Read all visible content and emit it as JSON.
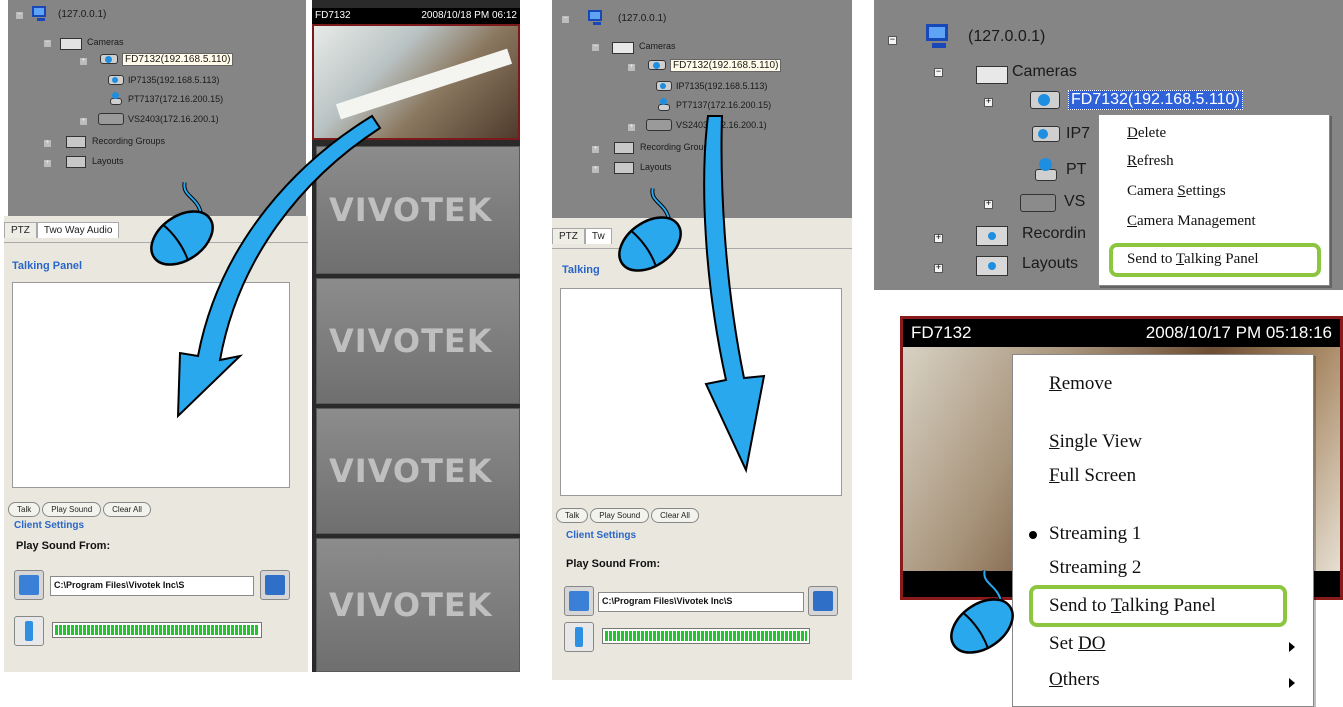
{
  "tree": {
    "root": "(127.0.0.1)",
    "cameras": "Cameras",
    "items": [
      "FD7132(192.168.5.110)",
      "IP7135(192.168.5.113)",
      "PT7137(172.16.200.15)",
      "VS2403(172.16.200.1)"
    ],
    "recording_groups": "Recording Groups",
    "layouts": "Layouts"
  },
  "tree_crop": {
    "root": "(127.0.0.1)",
    "cameras": "Cameras",
    "selected": "FD7132(192.168.5.110)",
    "ip_partial": "IP7",
    "pt_partial": "PT",
    "vs_partial": "VS",
    "recording_partial": "Recordin",
    "layouts": "Layouts"
  },
  "tabs": {
    "ptz": "PTZ",
    "two_way": "Two Way Audio",
    "two_way_partial": "Tw"
  },
  "talking_panel": {
    "title": "Talking Panel",
    "title_partial": "Talking",
    "buttons": [
      "Talk",
      "Play Sound",
      "Clear All"
    ],
    "client_settings": "Client Settings",
    "play_sound_from": "Play Sound From:",
    "path": "C:\\Program Files\\Vivotek Inc\\S"
  },
  "video": {
    "camera": "FD7132",
    "datetime_partial": "2008/10/18 PM 06:12",
    "camera2": "FD7132",
    "datetime2": "2008/10/17 PM 05:18:16",
    "logo": "VIVOTEK"
  },
  "tree_menu": {
    "items": [
      {
        "pre": "",
        "acc": "D",
        "post": "elete"
      },
      {
        "pre": "",
        "acc": "R",
        "post": "efresh"
      },
      {
        "pre": "Camera ",
        "acc": "S",
        "post": "ettings"
      },
      {
        "pre": "",
        "acc": "C",
        "post": "amera Management"
      },
      {
        "pre": "Send to ",
        "acc": "T",
        "post": "alking Panel"
      }
    ]
  },
  "video_menu": {
    "remove": {
      "acc": "R",
      "post": "emove"
    },
    "single_view": {
      "acc": "S",
      "post": "ingle View"
    },
    "full_screen": {
      "acc": "F",
      "post": "ull Screen"
    },
    "streaming1": "Streaming 1",
    "streaming2": "Streaming 2",
    "send": {
      "pre": "Send to ",
      "acc": "T",
      "post": "alking Panel"
    },
    "set_do": {
      "pre": "Set ",
      "acc": "DO",
      "post": ""
    },
    "others": {
      "pre": "",
      "acc": "O",
      "post": "thers"
    }
  },
  "colors": {
    "tree_bg": "#858585",
    "highlight_green": "#8cc63f",
    "arrow_blue": "#29a8ee",
    "selection_blue": "#2f62d8",
    "title_blue": "#2a66c8"
  },
  "icons": [
    "monitor-icon",
    "folder-icon",
    "camera-icon",
    "mouse-icon",
    "arrow-icon",
    "speaker-icon",
    "microphone-icon",
    "submenu-arrow-icon"
  ]
}
